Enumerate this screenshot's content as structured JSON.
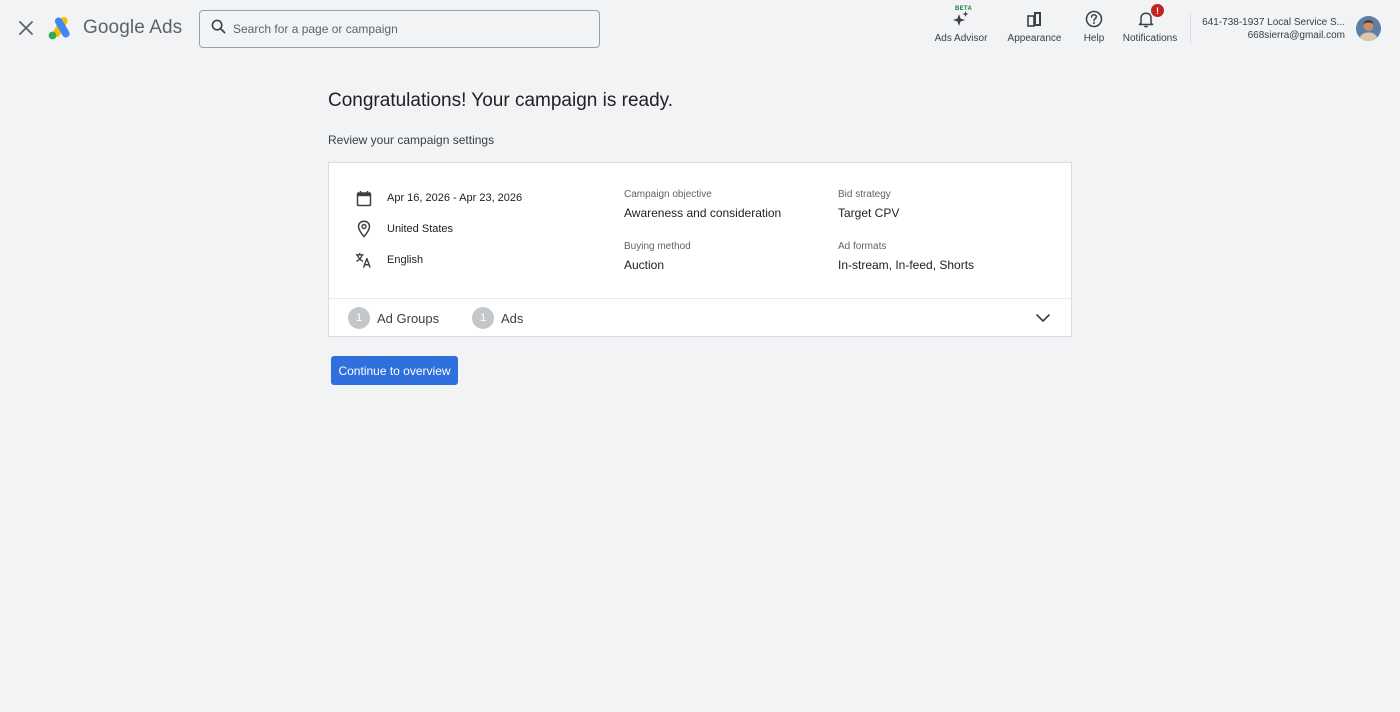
{
  "header": {
    "brand": "Google Ads",
    "search_placeholder": "Search for a page or campaign",
    "tools": {
      "ads_advisor": "Ads Advisor",
      "beta": "BETA",
      "appearance": "Appearance",
      "help": "Help",
      "notifications": "Notifications",
      "notification_badge": "!"
    },
    "account": {
      "name": "641-738-1937 Local Service S...",
      "email": "668sierra@gmail.com"
    }
  },
  "main": {
    "title": "Congratulations! Your campaign is ready.",
    "subtitle": "Review your campaign settings",
    "summary": {
      "date_range": "Apr 16, 2026 - Apr 23, 2026",
      "location": "United States",
      "language": "English",
      "fields": {
        "objective_label": "Campaign objective",
        "objective_value": "Awareness and consideration",
        "buying_label": "Buying method",
        "buying_value": "Auction",
        "bid_label": "Bid strategy",
        "bid_value": "Target CPV",
        "formats_label": "Ad formats",
        "formats_value": "In-stream, In-feed, Shorts"
      },
      "counts": {
        "ad_groups_count": "1",
        "ad_groups_label": "Ad Groups",
        "ads_count": "1",
        "ads_label": "Ads"
      }
    },
    "continue_label": "Continue to overview"
  },
  "icons": [
    "close-icon",
    "google-ads-logo",
    "search-icon",
    "sparkle-icon",
    "appearance-icon",
    "help-icon",
    "bell-icon",
    "calendar-icon",
    "location-pin-icon",
    "translate-icon",
    "chevron-down-icon"
  ],
  "colors": {
    "background": "#f1f3f4",
    "primary_button": "#2f6fde",
    "notification_badge": "#c5221f",
    "beta": "#188038"
  }
}
